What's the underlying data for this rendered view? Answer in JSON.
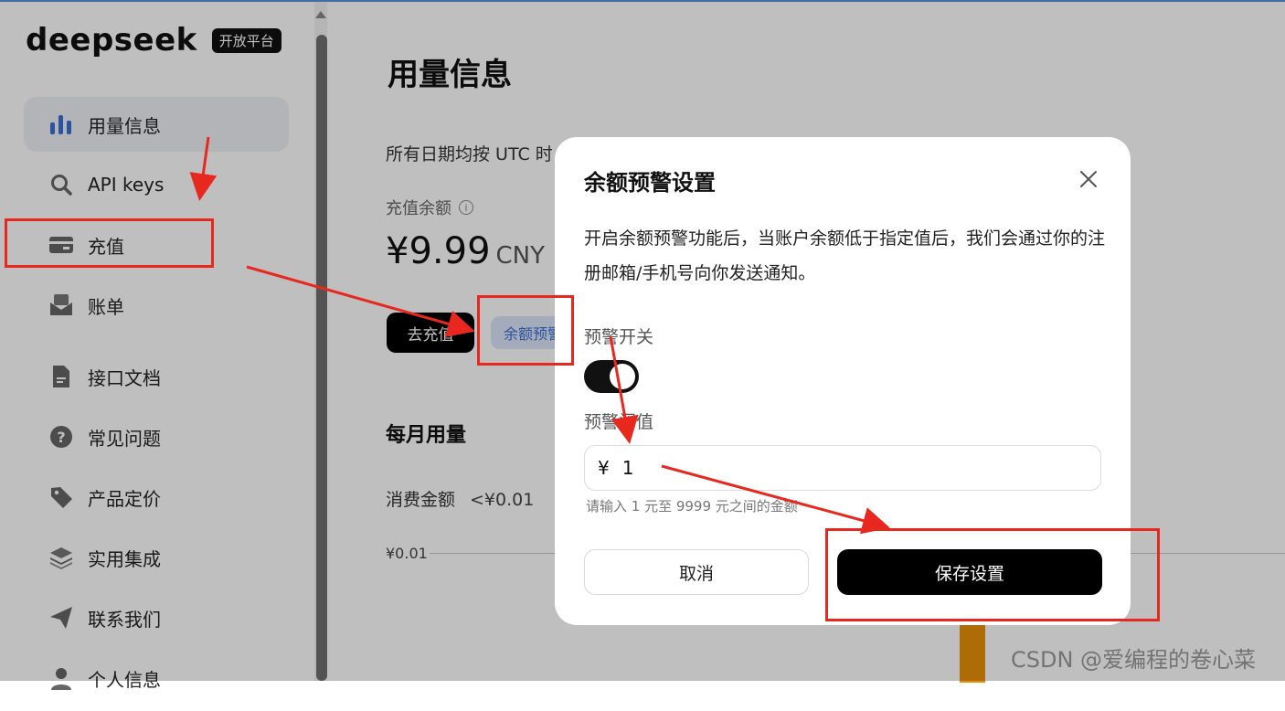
{
  "app": {
    "logo": "deepseek",
    "badge": "开放平台"
  },
  "sidebar": {
    "items": [
      {
        "label": "用量信息",
        "icon": "bar-chart-icon"
      },
      {
        "label": "API keys",
        "icon": "search-icon"
      },
      {
        "label": "充值",
        "icon": "wallet-icon"
      },
      {
        "label": "账单",
        "icon": "envelope-icon"
      },
      {
        "label": "接口文档",
        "icon": "document-icon"
      },
      {
        "label": "常见问题",
        "icon": "question-icon"
      },
      {
        "label": "产品定价",
        "icon": "tag-icon"
      },
      {
        "label": "实用集成",
        "icon": "layers-icon"
      },
      {
        "label": "联系我们",
        "icon": "send-icon"
      },
      {
        "label": "个人信息",
        "icon": "user-icon"
      }
    ]
  },
  "main": {
    "title": "用量信息",
    "utc_note": "所有日期均按 UTC 时",
    "balance_label": "充值余额",
    "info_glyph": "i",
    "balance_amount": "¥9.99",
    "balance_unit": "CNY",
    "recharge_button": "去充值",
    "alert_button": "余额预警",
    "monthly_title": "每月用量",
    "spend_label": "消费金额",
    "spend_value": "<¥0.01",
    "axis_label": "¥0.01"
  },
  "dialog": {
    "title": "余额预警设置",
    "description": "开启余额预警功能后，当账户余额低于指定值后，我们会通过你的注册邮箱/手机号向你发送通知。",
    "switch_label": "预警开关",
    "switch_on": true,
    "threshold_label": "预警阈值",
    "currency_prefix": "¥",
    "threshold_value": "1",
    "threshold_hint": "请输入 1 元至 9999 元之间的金额",
    "cancel_button": "取消",
    "save_button": "保存设置"
  },
  "colors": {
    "annotation": "#e8281e",
    "primary_button": "#000000",
    "alert_button_bg": "#dbe6fb",
    "alert_button_text": "#3d6fd4",
    "chart_bar": "#e8900a"
  },
  "watermark": "CSDN @爱编程的卷心菜"
}
